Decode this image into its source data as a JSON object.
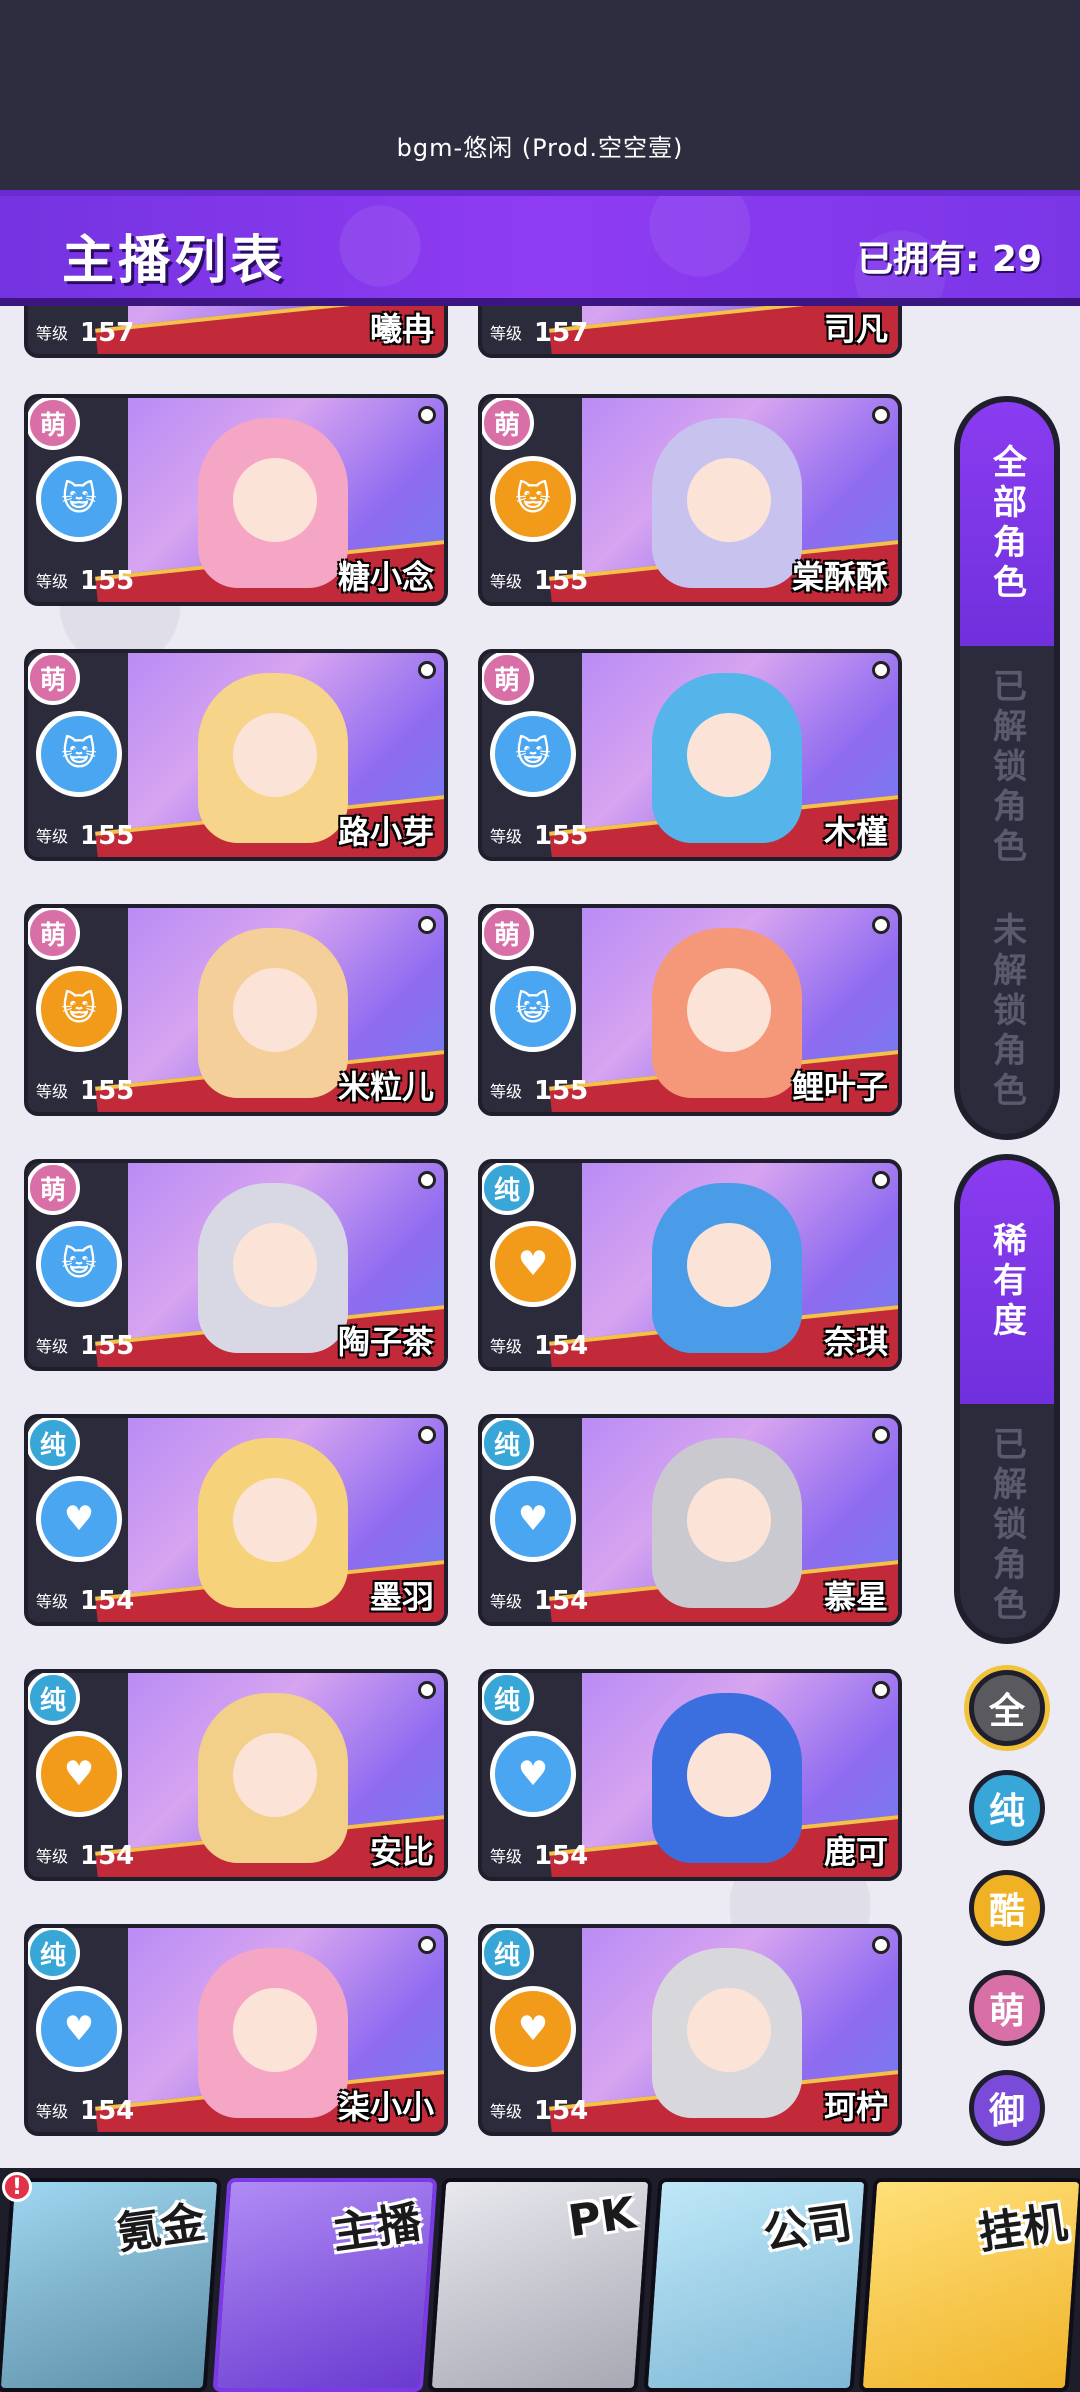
{
  "status": {
    "bgm": "bgm-悠闲 (Prod.空空壹)"
  },
  "header": {
    "title": "主播列表",
    "owned": "已拥有: 29"
  },
  "partial_row": [
    {
      "level_label": "等级",
      "level": "157",
      "name": "曦冉"
    },
    {
      "level_label": "等级",
      "level": "157",
      "name": "司凡"
    }
  ],
  "cards": [
    {
      "rarity": "萌",
      "emblem": "cat",
      "level_label": "等级",
      "level": "155",
      "name": "糖小念"
    },
    {
      "rarity": "萌",
      "emblem": "cat",
      "level_label": "等级",
      "level": "155",
      "name": "棠酥酥"
    },
    {
      "rarity": "萌",
      "emblem": "cat",
      "level_label": "等级",
      "level": "155",
      "name": "路小芽"
    },
    {
      "rarity": "萌",
      "emblem": "cat",
      "level_label": "等级",
      "level": "155",
      "name": "木槿"
    },
    {
      "rarity": "萌",
      "emblem": "cat",
      "level_label": "等级",
      "level": "155",
      "name": "米粒儿"
    },
    {
      "rarity": "萌",
      "emblem": "cat",
      "level_label": "等级",
      "level": "155",
      "name": "鲤叶子"
    },
    {
      "rarity": "萌",
      "emblem": "cat",
      "level_label": "等级",
      "level": "155",
      "name": "陶子茶"
    },
    {
      "rarity": "纯",
      "emblem": "heartbeat",
      "level_label": "等级",
      "level": "154",
      "name": "奈琪"
    },
    {
      "rarity": "纯",
      "emblem": "heartbeat",
      "level_label": "等级",
      "level": "154",
      "name": "墨羽"
    },
    {
      "rarity": "纯",
      "emblem": "heartbeat",
      "level_label": "等级",
      "level": "154",
      "name": "慕星"
    },
    {
      "rarity": "纯",
      "emblem": "heartbeat",
      "level_label": "等级",
      "level": "154",
      "name": "安比"
    },
    {
      "rarity": "纯",
      "emblem": "heartbeat",
      "level_label": "等级",
      "level": "154",
      "name": "鹿可"
    },
    {
      "rarity": "纯",
      "emblem": "heartbeat",
      "level_label": "等级",
      "level": "154",
      "name": "柒小小"
    },
    {
      "rarity": "纯",
      "emblem": "heartbeat",
      "level_label": "等级",
      "level": "154",
      "name": "珂柠"
    }
  ],
  "filters": {
    "roles": [
      "全部角色",
      "已解锁角色",
      "未解锁角色"
    ],
    "rarity_group": [
      "稀有度",
      "已解锁角色"
    ],
    "rarity_buttons": [
      "全",
      "纯",
      "酷",
      "萌",
      "御"
    ]
  },
  "nav": [
    "氪金",
    "主播",
    "PK",
    "公司",
    "挂机"
  ],
  "nav_badge": "!",
  "colors": {
    "accent": "#8a3cf0",
    "rarity_meng": "#d86fa6",
    "rarity_chun": "#39a6d8",
    "rarity_ku": "#f0b124",
    "rarity_yu": "#7a4ad8",
    "emblem_blue": "#4aa6f0",
    "emblem_orange": "#f29a1a"
  }
}
